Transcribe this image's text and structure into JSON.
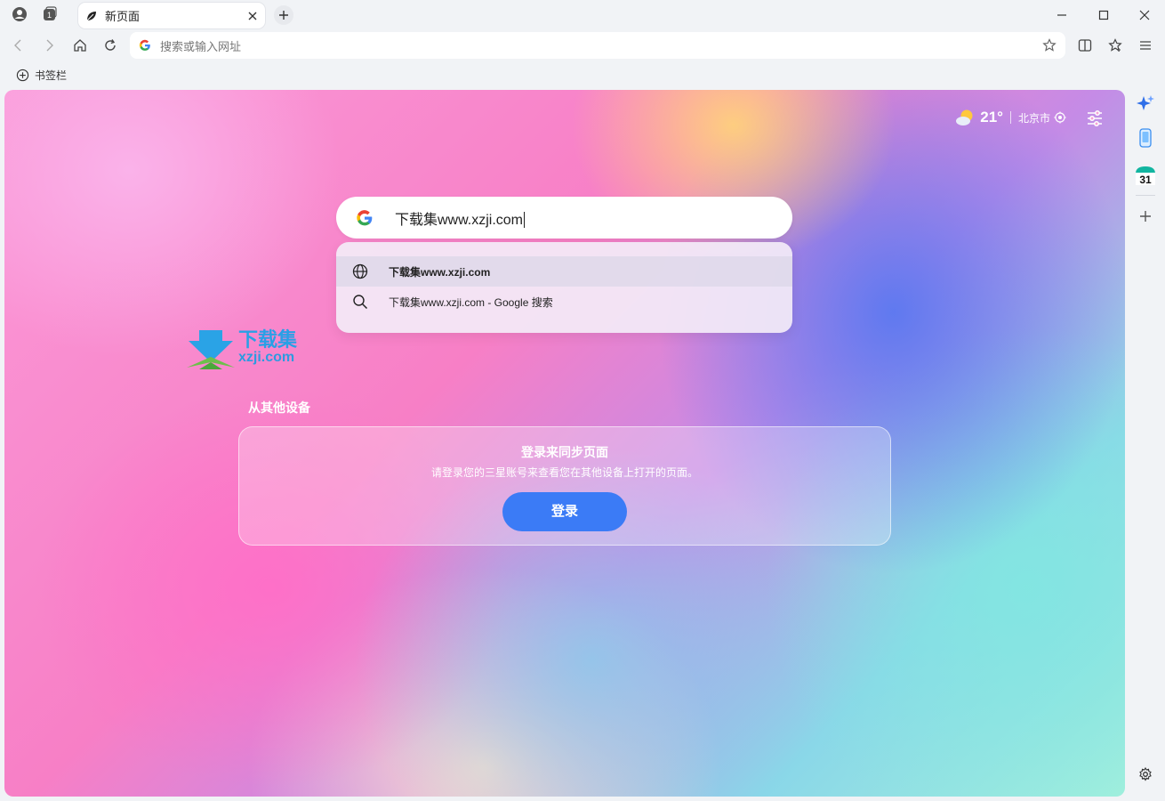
{
  "tab": {
    "title": "新页面"
  },
  "omnibox": {
    "placeholder": "搜索或输入网址"
  },
  "bookmarks": {
    "label": "书签栏"
  },
  "weather": {
    "temperature": "21°",
    "city": "北京市"
  },
  "search": {
    "query": "下载集www.xzji.com"
  },
  "suggestions": [
    {
      "text": "下载集www.xzji.com",
      "icon": "globe-icon"
    },
    {
      "text": "下载集www.xzji.com - Google 搜索",
      "icon": "search-icon"
    }
  ],
  "watermark": {
    "title": "下载集",
    "subtitle": "xzji.com"
  },
  "sync": {
    "section_title": "从其他设备",
    "heading": "登录来同步页面",
    "description": "请登录您的三星账号来查看您在其他设备上打开的页面。",
    "button": "登录"
  },
  "sidepanel": {
    "calendar_day": "31"
  },
  "colors": {
    "accent": "#3b7bf6",
    "watermark": "#28a0e6"
  }
}
